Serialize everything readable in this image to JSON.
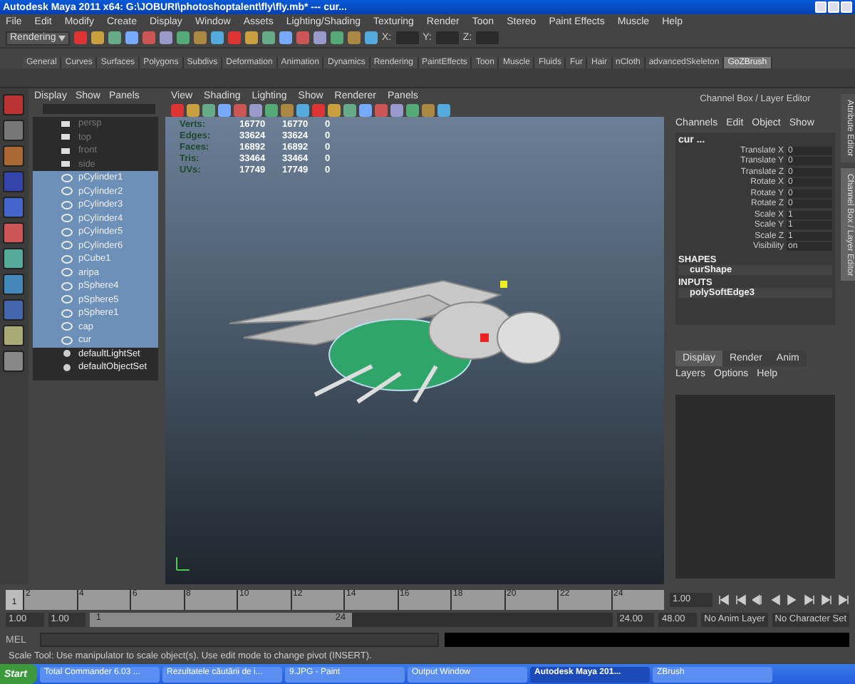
{
  "window": {
    "title": "Autodesk Maya 2011 x64: G:\\JOBURI\\photoshoptalent\\fly\\fly.mb*  ---  cur..."
  },
  "menu_bar": [
    "File",
    "Edit",
    "Modify",
    "Create",
    "Display",
    "Window",
    "Assets",
    "Lighting/Shading",
    "Texturing",
    "Render",
    "Toon",
    "Stereo",
    "Paint Effects",
    "Muscle",
    "Help"
  ],
  "toolbar": {
    "mode_menu": "Rendering",
    "coord_labels": [
      "X:",
      "Y:",
      "Z:"
    ]
  },
  "shelf_tabs": [
    {
      "label": "General",
      "selected": false
    },
    {
      "label": "Curves",
      "selected": false
    },
    {
      "label": "Surfaces",
      "selected": false
    },
    {
      "label": "Polygons",
      "selected": false
    },
    {
      "label": "Subdivs",
      "selected": false
    },
    {
      "label": "Deformation",
      "selected": false
    },
    {
      "label": "Animation",
      "selected": false
    },
    {
      "label": "Dynamics",
      "selected": false
    },
    {
      "label": "Rendering",
      "selected": false
    },
    {
      "label": "PaintEffects",
      "selected": false
    },
    {
      "label": "Toon",
      "selected": false
    },
    {
      "label": "Muscle",
      "selected": false
    },
    {
      "label": "Fluids",
      "selected": false
    },
    {
      "label": "Fur",
      "selected": false
    },
    {
      "label": "Hair",
      "selected": false
    },
    {
      "label": "nCloth",
      "selected": false
    },
    {
      "label": "advancedSkeleton",
      "selected": false
    },
    {
      "label": "GoZBrush",
      "selected": true
    }
  ],
  "outliner": {
    "menu": [
      "Display",
      "Show",
      "Panels"
    ],
    "items": [
      {
        "label": "persp",
        "kind": "camera",
        "selected": false
      },
      {
        "label": "top",
        "kind": "camera",
        "selected": false
      },
      {
        "label": "front",
        "kind": "camera",
        "selected": false
      },
      {
        "label": "side",
        "kind": "camera",
        "selected": false
      },
      {
        "label": "pCylinder1",
        "kind": "mesh",
        "selected": true
      },
      {
        "label": "pCylinder2",
        "kind": "mesh",
        "selected": true
      },
      {
        "label": "pCylinder3",
        "kind": "mesh",
        "selected": true
      },
      {
        "label": "pCylinder4",
        "kind": "mesh",
        "selected": true
      },
      {
        "label": "pCylinder5",
        "kind": "mesh",
        "selected": true
      },
      {
        "label": "pCylinder6",
        "kind": "mesh",
        "selected": true
      },
      {
        "label": "pCube1",
        "kind": "mesh",
        "selected": true
      },
      {
        "label": "aripa",
        "kind": "mesh",
        "selected": true
      },
      {
        "label": "pSphere4",
        "kind": "mesh",
        "selected": true
      },
      {
        "label": "pSphere5",
        "kind": "mesh",
        "selected": true
      },
      {
        "label": "pSphere1",
        "kind": "mesh",
        "selected": true
      },
      {
        "label": "cap",
        "kind": "mesh",
        "selected": true
      },
      {
        "label": "cur",
        "kind": "mesh",
        "selected": true
      },
      {
        "label": "defaultLightSet",
        "kind": "set",
        "selected": false
      },
      {
        "label": "defaultObjectSet",
        "kind": "set",
        "selected": false
      }
    ]
  },
  "viewport": {
    "menu": [
      "View",
      "Shading",
      "Lighting",
      "Show",
      "Renderer",
      "Panels"
    ],
    "stats": [
      {
        "label": "Verts:",
        "values": [
          "16770",
          "16770",
          "0"
        ]
      },
      {
        "label": "Edges:",
        "values": [
          "33624",
          "33624",
          "0"
        ]
      },
      {
        "label": "Faces:",
        "values": [
          "16892",
          "16892",
          "0"
        ]
      },
      {
        "label": "Tris:",
        "values": [
          "33464",
          "33464",
          "0"
        ]
      },
      {
        "label": "UVs:",
        "values": [
          "17749",
          "17749",
          "0"
        ]
      }
    ]
  },
  "channel_box": {
    "title": "Channel Box / Layer Editor",
    "menu": [
      "Channels",
      "Edit",
      "Object",
      "Show"
    ],
    "object": "cur ...",
    "channels": [
      {
        "name": "Translate X",
        "value": "0"
      },
      {
        "name": "Translate Y",
        "value": "0"
      },
      {
        "name": "Translate Z",
        "value": "0"
      },
      {
        "name": "Rotate X",
        "value": "0"
      },
      {
        "name": "Rotate Y",
        "value": "0"
      },
      {
        "name": "Rotate Z",
        "value": "0"
      },
      {
        "name": "Scale X",
        "value": "1"
      },
      {
        "name": "Scale Y",
        "value": "1"
      },
      {
        "name": "Scale Z",
        "value": "1"
      },
      {
        "name": "Visibility",
        "value": "on"
      }
    ],
    "shapes_header": "SHAPES",
    "shape": "curShape",
    "inputs_header": "INPUTS",
    "input": "polySoftEdge3"
  },
  "layer_editor": {
    "tabs": [
      {
        "label": "Display",
        "selected": true
      },
      {
        "label": "Render",
        "selected": false
      },
      {
        "label": "Anim",
        "selected": false
      }
    ],
    "menu": [
      "Layers",
      "Options",
      "Help"
    ]
  },
  "side_tabs": [
    {
      "label": "Attribute Editor",
      "selected": false
    },
    {
      "label": "Channel Box / Layer Editor",
      "selected": true
    }
  ],
  "timeline": {
    "level": 0,
    "ticks": [
      "2",
      "4",
      "6",
      "8",
      "10",
      "12",
      "14",
      "16",
      "18",
      "20",
      "22",
      "24"
    ],
    "current_frame": "1",
    "frame_field": "1.00"
  },
  "range": {
    "start": "1.00",
    "playback_start": "1.00",
    "slider_start": "1",
    "slider_end": "24",
    "level": 0.5,
    "playback_end": "24.00",
    "end": "48.00",
    "anim_layer": "No Anim Layer",
    "character_set": "No Character Set"
  },
  "command_line": {
    "label": "MEL"
  },
  "help_line": "Scale Tool: Use manipulator to scale object(s). Use edit mode to change pivot (INSERT).",
  "taskbar": {
    "start": "Start",
    "items": [
      {
        "label": "Total Commander 6.03 ...",
        "selected": false
      },
      {
        "label": "Rezultatele căutării de i...",
        "selected": false
      },
      {
        "label": "9.JPG - Paint",
        "selected": false
      },
      {
        "label": "Output Window",
        "selected": false
      },
      {
        "label": "Autodesk Maya 201...",
        "selected": true
      },
      {
        "label": "ZBrush",
        "selected": false
      }
    ]
  }
}
